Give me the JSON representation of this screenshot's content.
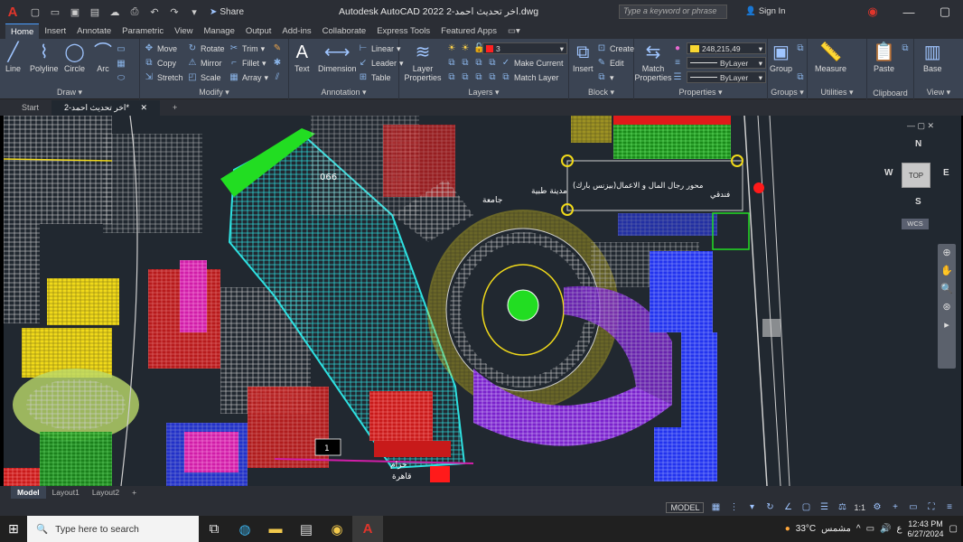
{
  "titlebar": {
    "share_label": "Share",
    "window_title": "Autodesk AutoCAD 2022  2-اخر تحديث احمد.dwg",
    "search_placeholder": "Type a keyword or phrase",
    "sign_in_label": "Sign In"
  },
  "menu": {
    "tabs": [
      "Home",
      "Insert",
      "Annotate",
      "Parametric",
      "View",
      "Manage",
      "Output",
      "Add-ins",
      "Collaborate",
      "Express Tools",
      "Featured Apps"
    ]
  },
  "ribbon": {
    "draw": {
      "title": "Draw",
      "line": "Line",
      "polyline": "Polyline",
      "circle": "Circle",
      "arc": "Arc"
    },
    "modify": {
      "title": "Modify",
      "move": "Move",
      "rotate": "Rotate",
      "trim": "Trim",
      "copy": "Copy",
      "mirror": "Mirror",
      "fillet": "Fillet",
      "stretch": "Stretch",
      "scale": "Scale",
      "array": "Array"
    },
    "annotation": {
      "title": "Annotation",
      "text": "Text",
      "dimension": "Dimension",
      "linear": "Linear",
      "leader": "Leader",
      "table": "Table"
    },
    "layers": {
      "title": "Layers",
      "properties": "Layer Properties",
      "current_layer": "3",
      "make_current": "Make Current",
      "match_layer": "Match Layer"
    },
    "block": {
      "title": "Block",
      "insert": "Insert",
      "create": "Create",
      "edit": "Edit"
    },
    "properties": {
      "title": "Properties",
      "match": "Match Properties",
      "color": "248,215,49",
      "linetype": "ByLayer",
      "lineweight": "ByLayer"
    },
    "groups": {
      "title": "Groups",
      "group": "Group"
    },
    "utilities": {
      "title": "Utilities",
      "measure": "Measure"
    },
    "clipboard": {
      "title": "Clipboard",
      "paste": "Paste"
    },
    "view": {
      "title": "View",
      "base": "Base"
    }
  },
  "doc_tabs": [
    "Start",
    "2-اخر تحديث احمد*"
  ],
  "drawing": {
    "labels": {
      "label_066": "066",
      "mosque": "جامعة",
      "medical_city": "مدينة طبية",
      "business_axis": "محور رجال المال و الاعمال(بيزنس بارك)",
      "hotel": "فندقي",
      "belt": "حزام",
      "cairo": "قاهرة",
      "num_1": "1"
    }
  },
  "viewcube": {
    "top": "TOP",
    "n": "N",
    "s": "S",
    "e": "E",
    "w": "W",
    "wcs": "WCS"
  },
  "layout_tabs": [
    "Model",
    "Layout1",
    "Layout2"
  ],
  "status": {
    "model": "MODEL",
    "scale": "1:1"
  },
  "taskbar": {
    "search_placeholder": "Type here to search",
    "weather": "33°C",
    "weather_desc": "مشمس",
    "lang": "ع",
    "time": "12:43 PM",
    "date": "6/27/2024"
  },
  "colors": {
    "accent": "#4a9eff",
    "brand": "#e0352b",
    "canvas": "#212830"
  }
}
